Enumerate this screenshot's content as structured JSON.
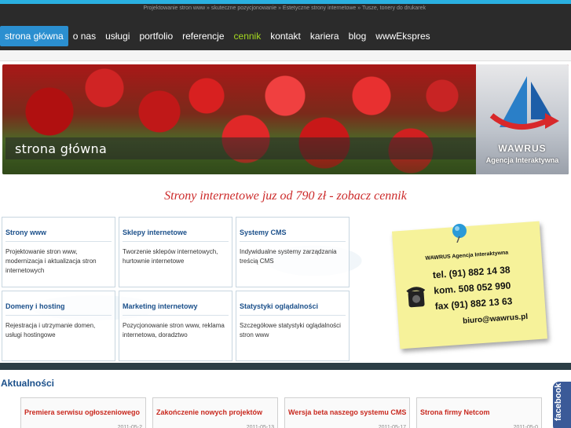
{
  "header": {
    "tagline": "Projektowanie stron www » skuteczne pozycjonowanie » Estetyczne strony internetowe » Tusze, tonery do drukarek",
    "nav": [
      {
        "label": "strona główna"
      },
      {
        "label": "o nas"
      },
      {
        "label": "usługi"
      },
      {
        "label": "portfolio"
      },
      {
        "label": "referencje"
      },
      {
        "label": "cennik"
      },
      {
        "label": "kontakt"
      },
      {
        "label": "kariera"
      },
      {
        "label": "blog"
      },
      {
        "label": "wwwEkspres"
      }
    ],
    "active_nav": "strona główna",
    "highlight_nav": "cennik"
  },
  "banner": {
    "title": "strona główna",
    "logo_name": "WAWRUS",
    "logo_sub": "Agencja Interaktywna"
  },
  "promo": "Strony internetowe juz od 790 zł - zobacz cennik",
  "services": [
    {
      "title": "Strony www",
      "desc": "Projektowanie stron www, modernizacja i aktualizacja stron internetowych"
    },
    {
      "title": "Sklepy internetowe",
      "desc": "Tworzenie sklepów internetowych, hurtownie internetowe"
    },
    {
      "title": "Systemy CMS",
      "desc": "Indywidualne systemy zarządzania treścią CMS"
    },
    {
      "title": "Domeny i hosting",
      "desc": "Rejestracja i utrzymanie domen, usługi hostingowe"
    },
    {
      "title": "Marketing internetowy",
      "desc": "Pozycjonowanie stron www, reklama internetowa, doradztwo"
    },
    {
      "title": "Statystyki oglądalności",
      "desc": "Szczegółowe statystyki oglądalności stron www"
    }
  ],
  "contact_note": {
    "company": "WAWRUS Agencja Interaktywna",
    "tel": "tel. (91) 882 14 38",
    "kom": "kom. 508 052 990",
    "fax": "fax (91) 882 13 63",
    "email": "biuro@wawrus.pl"
  },
  "news": {
    "heading": "Aktualności",
    "items": [
      {
        "title": "Premiera serwisu ogłoszeniowego",
        "date": "2011-05-2"
      },
      {
        "title": "Zakończenie nowych projektów",
        "date": "2011-05-13"
      },
      {
        "title": "Wersja beta naszego systemu CMS",
        "date": "2011-05-17"
      },
      {
        "title": "Strona firmy Netcom",
        "date": "2011-05-0"
      }
    ]
  },
  "facebook_tab": "facebook",
  "colors": {
    "nav_active_bg": "#2b8fd0",
    "nav_highlight": "#a4d820",
    "promo_red": "#cc2a2a",
    "service_title": "#1a4f8a",
    "news_title": "#c8281e",
    "accent_cyan": "#2ab0e0"
  }
}
